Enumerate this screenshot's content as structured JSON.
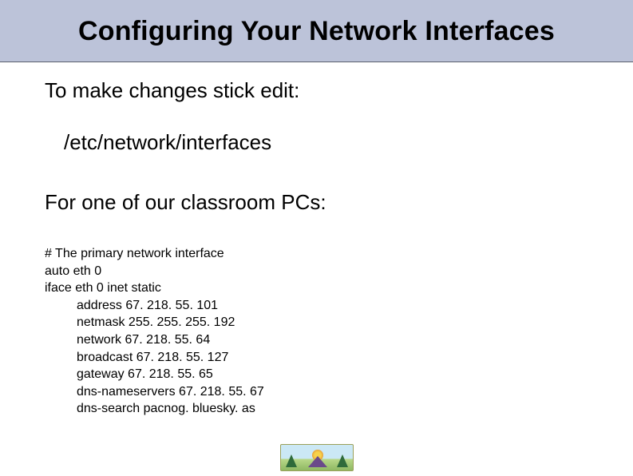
{
  "title": "Configuring Your Network Interfaces",
  "intro": "To make changes stick edit:",
  "file_path": "/etc/network/interfaces",
  "subhead": "For one of our classroom PCs:",
  "config": {
    "comment": "# The primary network interface",
    "auto": "auto eth 0",
    "iface": "iface eth 0 inet static",
    "address": "address 67. 218. 55. 101",
    "netmask": "netmask 255. 255. 255. 192",
    "network": "network 67. 218. 55. 64",
    "broadcast": "broadcast 67. 218. 55. 127",
    "gateway": "gateway 67. 218. 55. 65",
    "dns_ns": "dns-nameservers 67. 218. 55. 67",
    "dns_search": "dns-search pacnog. bluesky. as"
  }
}
